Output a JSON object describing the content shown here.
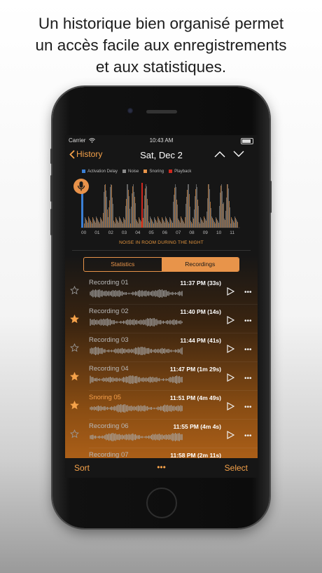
{
  "caption": {
    "lines": [
      "Un historique bien organisé permet",
      "un accès facile aux enregistrements",
      "et aux statistiques."
    ]
  },
  "status_bar": {
    "carrier": "Carrier",
    "time": "10:43 AM"
  },
  "nav": {
    "back_label": "History",
    "title": "Sat, Dec 2"
  },
  "legend": [
    {
      "label": "Activation Delay",
      "color": "#3a7fd5"
    },
    {
      "label": "Noise",
      "color": "#8a8a8a"
    },
    {
      "label": "Snoring",
      "color": "#e8944a"
    },
    {
      "label": "Playback",
      "color": "#d0281e"
    }
  ],
  "chart": {
    "caption": "NOISE IN ROOM DURING THE NIGHT",
    "ticks": [
      "00",
      "01",
      "02",
      "03",
      "04",
      "05",
      "06",
      "07",
      "08",
      "09",
      "10",
      "11"
    ]
  },
  "tabs": {
    "statistics": "Statistics",
    "recordings": "Recordings",
    "selected": "Recordings"
  },
  "recordings": [
    {
      "name": "Recording 01",
      "time": "11:37 PM (33s)",
      "starred": false,
      "highlighted": false
    },
    {
      "name": "Recording 02",
      "time": "11:40 PM (14s)",
      "starred": true,
      "highlighted": false
    },
    {
      "name": "Recording 03",
      "time": "11:44 PM (41s)",
      "starred": false,
      "highlighted": false
    },
    {
      "name": "Recording 04",
      "time": "11:47 PM (1m 29s)",
      "starred": true,
      "highlighted": false
    },
    {
      "name": "Snoring 05",
      "time": "11:51 PM (4m 49s)",
      "starred": true,
      "highlighted": true
    },
    {
      "name": "Recording 06",
      "time": "11:55 PM (4m 4s)",
      "starred": false,
      "highlighted": false
    },
    {
      "name": "Recording 07",
      "time": "11:58 PM (2m 11s)",
      "starred": false,
      "highlighted": false
    }
  ],
  "toolbar": {
    "sort": "Sort",
    "more": "•••",
    "select": "Select"
  },
  "colors": {
    "accent": "#f5a24a",
    "snoring": "#e8944a",
    "playback": "#d0281e",
    "activation": "#3a7fd5"
  },
  "icons": {
    "back": "chevron-left-icon",
    "prev": "chevron-up-icon",
    "next": "chevron-down-icon",
    "mic": "microphone-icon",
    "star": "star-icon",
    "play": "play-icon",
    "more": "ellipsis-icon",
    "wifi": "wifi-icon",
    "battery": "battery-icon"
  }
}
